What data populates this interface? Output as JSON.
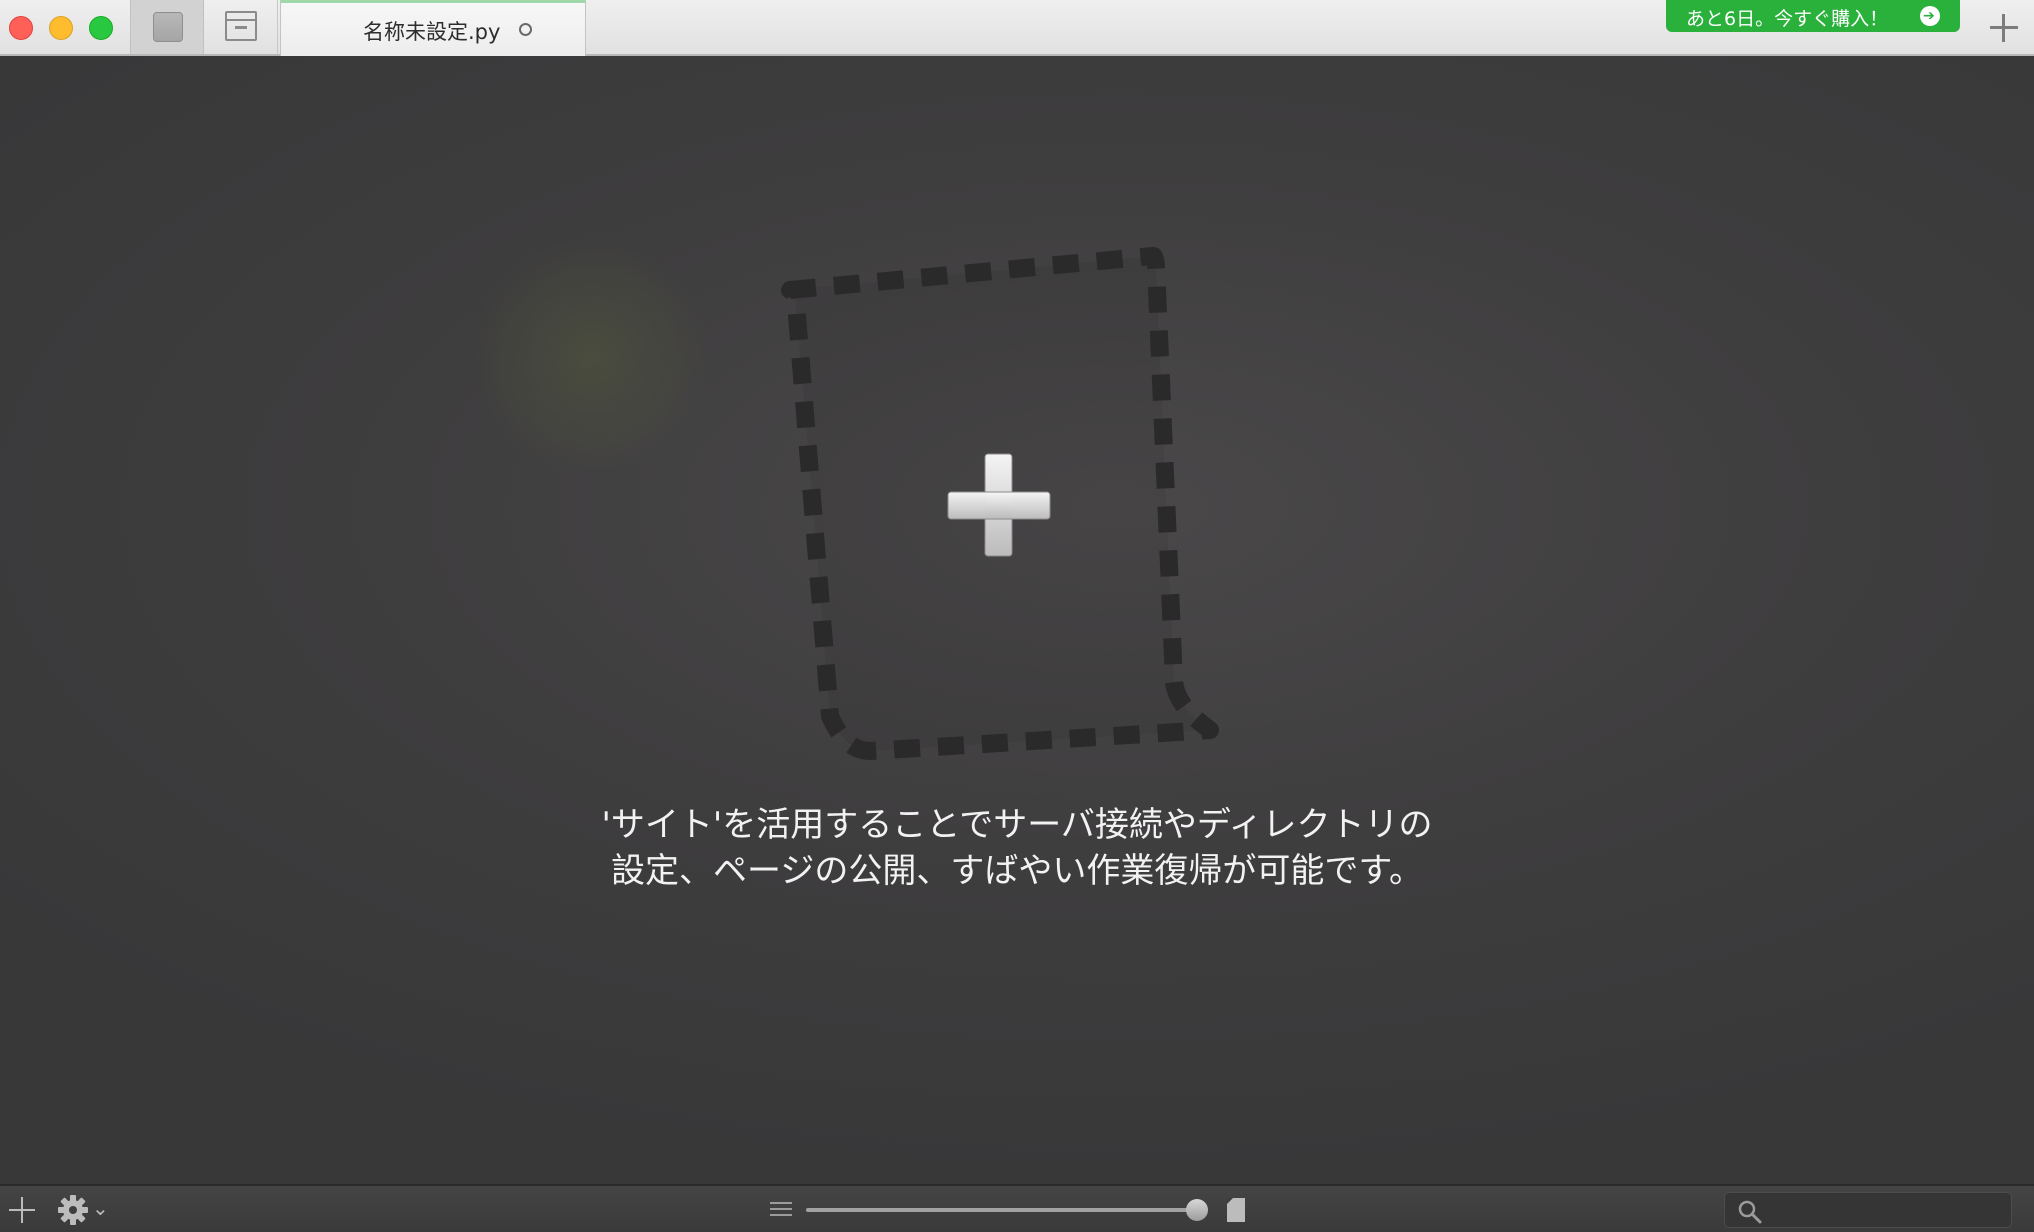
{
  "window": {
    "tab_title": "名称未設定.py",
    "buy_banner": "あと6日。今すぐ購入！"
  },
  "main": {
    "message_line1": "'サイト'を活用することでサーバ接続やディレクトリの",
    "message_line2": "設定、ページの公開、すばやい作業復帰が可能です。"
  },
  "icons": {
    "close": "close-button",
    "minimize": "minimize-button",
    "zoom": "zoom-button",
    "sidebar": "sidebar-toggle-icon",
    "archive": "archive-icon",
    "unsaved": "unsaved-dot-icon",
    "buy_arrow": "arrow-right-circle-icon",
    "new_tab": "plus-icon",
    "drop_zone": "dashed-drop-zone-plus-icon",
    "add": "plus-icon",
    "settings": "gear-icon",
    "dropdown": "chevron-down-icon",
    "lines": "lines-icon",
    "page": "page-icon",
    "search": "search-icon"
  },
  "colors": {
    "buy_banner": "#29b13c",
    "background": "#3e3d3e",
    "close": "#fe5f57",
    "minimize": "#febc2e",
    "zoom": "#28c840"
  }
}
